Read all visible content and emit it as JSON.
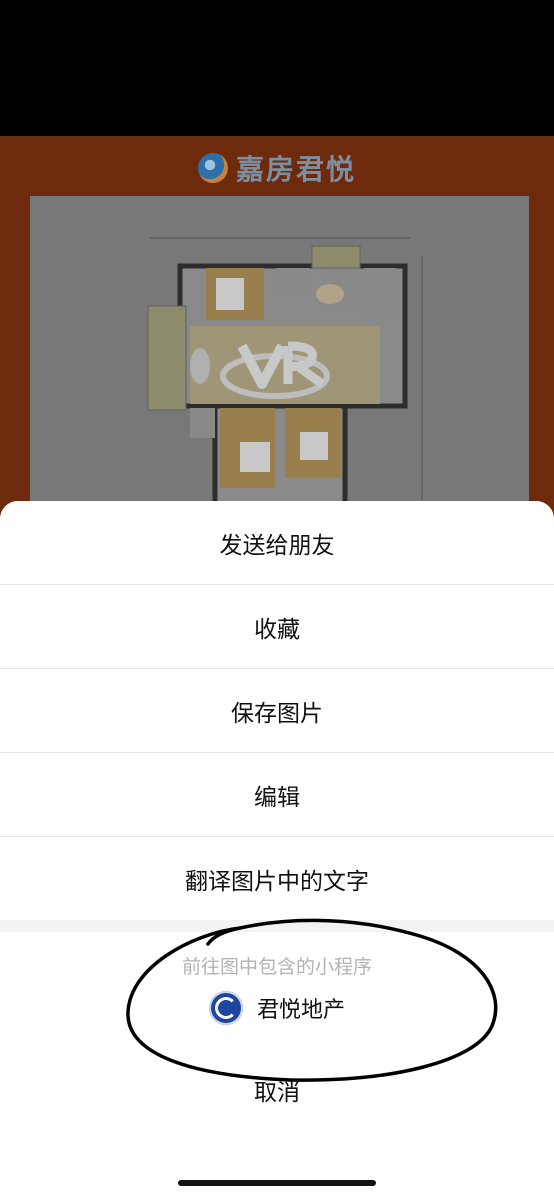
{
  "image": {
    "brand_name": "嘉房君悦"
  },
  "action_sheet": {
    "items": [
      {
        "label": "发送给朋友"
      },
      {
        "label": "收藏"
      },
      {
        "label": "保存图片"
      },
      {
        "label": "编辑"
      },
      {
        "label": "翻译图片中的文字"
      }
    ],
    "mini_program": {
      "title": "前往图中包含的小程序",
      "name": "君悦地产",
      "icon": "jun-yue-logo-icon"
    },
    "cancel_label": "取消"
  },
  "colors": {
    "image_background": "#6d2a0d",
    "sheet_background": "#ffffff",
    "annotation_stroke": "#000000",
    "mini_icon": "#1e46a0"
  }
}
